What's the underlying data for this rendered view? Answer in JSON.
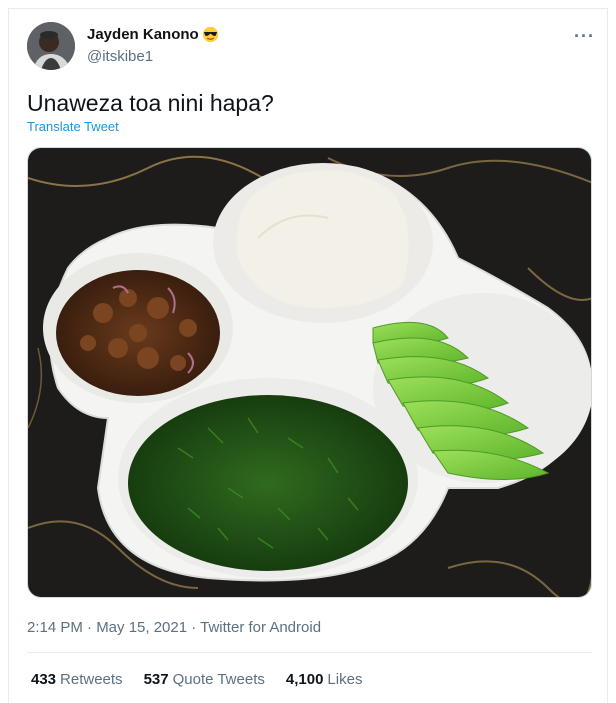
{
  "author": {
    "display_name": "Jayden Kanono",
    "emoji": "sunglasses-emoji",
    "handle": "@itskibe1"
  },
  "more_menu": "···",
  "tweet": {
    "text": "Unaweza toa nini hapa?",
    "translate_label": "Translate Tweet",
    "meta": "2:14 PM · May 15, 2021 · Twitter for Android"
  },
  "photo": {
    "subject": "food-platter",
    "sections": [
      "fried-meat",
      "ugali",
      "avocado-slices",
      "sukuma-greens"
    ]
  },
  "stats": {
    "retweets": {
      "count": "433",
      "label": "Retweets"
    },
    "quotes": {
      "count": "537",
      "label": "Quote Tweets"
    },
    "likes": {
      "count": "4,100",
      "label": "Likes"
    }
  },
  "colors": {
    "accent": "#1b95e0",
    "secondary_text": "#5b7083",
    "border": "#e6ecf0"
  }
}
